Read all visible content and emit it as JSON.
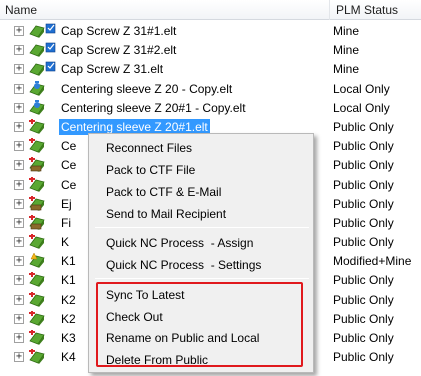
{
  "header": {
    "name": "Name",
    "plm_status": "PLM Status"
  },
  "rows": [
    {
      "name": "Cap Screw Z 31#1.elt",
      "status": "Mine",
      "icon": "part-mine-icon"
    },
    {
      "name": "Cap Screw Z 31#2.elt",
      "status": "Mine",
      "icon": "part-mine-icon"
    },
    {
      "name": "Cap Screw Z 31.elt",
      "status": "Mine",
      "icon": "part-mine-icon"
    },
    {
      "name": "Centering sleeve Z 20 - Copy.elt",
      "status": "Local Only",
      "icon": "part-local-icon"
    },
    {
      "name": "Centering sleeve Z 20#1 - Copy.elt",
      "status": "Local Only",
      "icon": "part-local-icon"
    },
    {
      "name": "Centering sleeve Z 20#1.elt",
      "status": "Public Only",
      "icon": "part-public-icon"
    },
    {
      "name": "Ce",
      "status": "Public Only",
      "icon": "part-public-icon"
    },
    {
      "name": "Ce",
      "status": "Public Only",
      "icon": "assembly-public-icon"
    },
    {
      "name": "Ce",
      "status": "Public Only",
      "icon": "part-public-icon"
    },
    {
      "name": "Ej",
      "status": "Public Only",
      "icon": "assembly-public-icon"
    },
    {
      "name": "Fi",
      "status": "Public Only",
      "icon": "assembly-public-icon"
    },
    {
      "name": "K",
      "status": "Public Only",
      "icon": "part-public-icon"
    },
    {
      "name": "K1",
      "status": "Modified+Mine",
      "icon": "part-modified-icon"
    },
    {
      "name": "K1",
      "status": "Public Only",
      "icon": "part-public-icon"
    },
    {
      "name": "K2",
      "status": "Public Only",
      "icon": "part-public-icon"
    },
    {
      "name": "K2",
      "status": "Public Only",
      "icon": "part-public-icon"
    },
    {
      "name": "K3",
      "status": "Public Only",
      "icon": "part-public-icon"
    },
    {
      "name": "K4",
      "status": "Public Only",
      "icon": "part-public-icon"
    }
  ],
  "context_menu": {
    "items": [
      "Reconnect Files",
      "Pack to CTF File",
      "Pack to CTF & E-Mail",
      "Send to Mail Recipient",
      "Quick NC Process  - Assign",
      "Quick NC Process  - Settings",
      "Sync To Latest",
      "Check Out",
      "Rename on Public and Local",
      "Delete From Public"
    ]
  },
  "colors": {
    "selection": "#3399ff",
    "highlight_border": "#e0191d"
  }
}
